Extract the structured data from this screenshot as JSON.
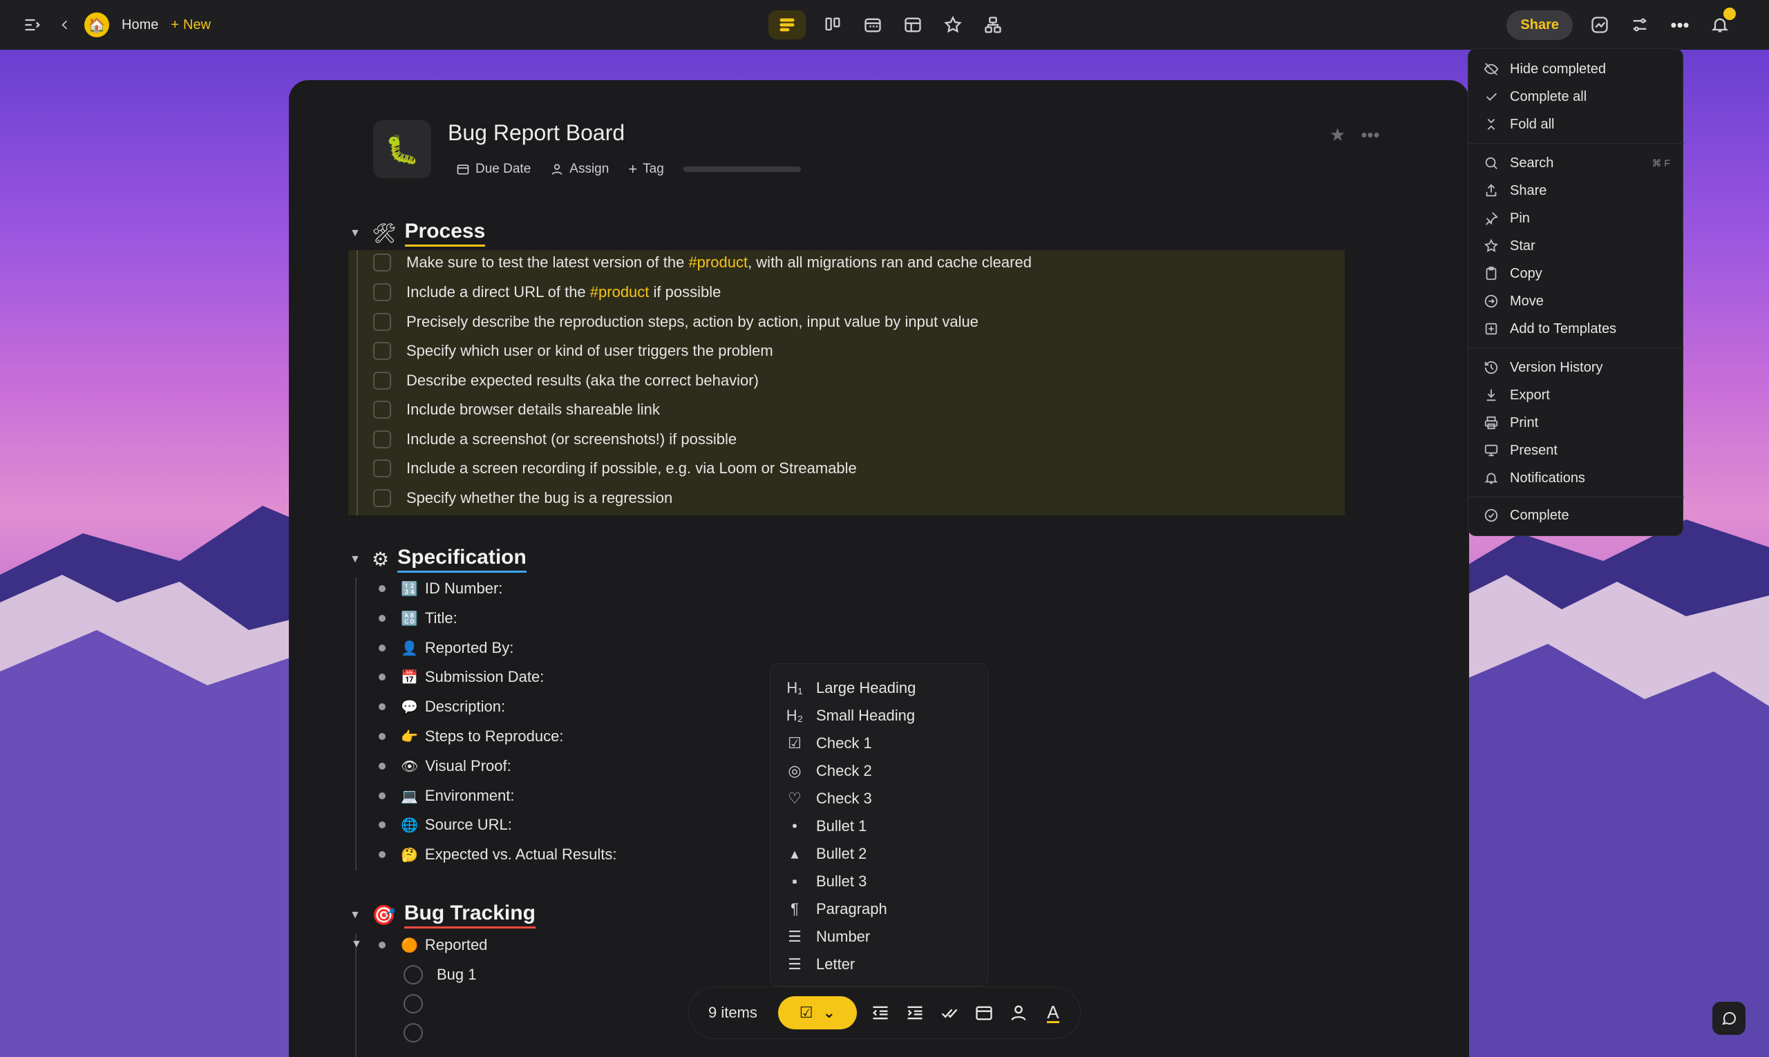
{
  "topbar": {
    "home_label": "Home",
    "new_label": "New",
    "share_label": "Share"
  },
  "document": {
    "title": "Bug Report Board",
    "due_date_label": "Due Date",
    "assign_label": "Assign",
    "tag_label": "Tag"
  },
  "process": {
    "title": "Process",
    "emoji": "🛠",
    "tasks": [
      {
        "pre": "Make sure to test the latest version of the ",
        "tag": "#product",
        "post": ", with all migrations ran and cache cleared"
      },
      {
        "pre": "Include a direct URL of the ",
        "tag": "#product",
        "post": " if possible"
      },
      {
        "pre": "Precisely describe the reproduction steps, action by action, input value by input value",
        "tag": "",
        "post": ""
      },
      {
        "pre": "Specify which user or kind of user triggers the problem",
        "tag": "",
        "post": ""
      },
      {
        "pre": "Describe expected results (aka the correct behavior)",
        "tag": "",
        "post": ""
      },
      {
        "pre": "Include browser details shareable link",
        "tag": "",
        "post": ""
      },
      {
        "pre": "Include a screenshot (or screenshots!) if possible",
        "tag": "",
        "post": ""
      },
      {
        "pre": "Include a screen recording if possible, e.g. via Loom or Streamable",
        "tag": "",
        "post": ""
      },
      {
        "pre": "Specify whether the bug is a regression",
        "tag": "",
        "post": ""
      }
    ]
  },
  "specification": {
    "title": "Specification",
    "emoji": "⚙",
    "items": [
      {
        "emoji": "🔢",
        "label": "ID Number:"
      },
      {
        "emoji": "🔠",
        "label": "Title:"
      },
      {
        "emoji": "👤",
        "label": "Reported By:"
      },
      {
        "emoji": "📅",
        "label": "Submission Date:"
      },
      {
        "emoji": "💬",
        "label": "Description:"
      },
      {
        "emoji": "👉",
        "label": "Steps to Reproduce:"
      },
      {
        "emoji": "👁",
        "label": "Visual Proof:"
      },
      {
        "emoji": "💻",
        "label": "Environment:"
      },
      {
        "emoji": "🌐",
        "label": "Source URL:"
      },
      {
        "emoji": "🤔",
        "label": "Expected vs. Actual Results:"
      }
    ]
  },
  "bug_tracking": {
    "title": "Bug Tracking",
    "emoji": "🎯",
    "status_emoji": "🟠",
    "status_label": "Reported",
    "bug1": "Bug 1"
  },
  "menu": {
    "hide_completed": "Hide completed",
    "complete_all": "Complete all",
    "fold_all": "Fold all",
    "search": "Search",
    "search_shortcut": "⌘ F",
    "share": "Share",
    "pin": "Pin",
    "star": "Star",
    "copy": "Copy",
    "move": "Move",
    "add_to_templates": "Add to Templates",
    "version_history": "Version History",
    "export": "Export",
    "print": "Print",
    "present": "Present",
    "notifications": "Notifications",
    "complete": "Complete"
  },
  "block_menu": {
    "items": [
      {
        "glyph": "H₁",
        "label": "Large Heading"
      },
      {
        "glyph": "H₂",
        "label": "Small Heading"
      },
      {
        "glyph": "☑",
        "label": "Check 1"
      },
      {
        "glyph": "◎",
        "label": "Check 2"
      },
      {
        "glyph": "♡",
        "label": "Check 3"
      },
      {
        "glyph": "•",
        "label": "Bullet 1"
      },
      {
        "glyph": "▴",
        "label": "Bullet 2"
      },
      {
        "glyph": "▪",
        "label": "Bullet 3"
      },
      {
        "glyph": "¶",
        "label": "Paragraph"
      },
      {
        "glyph": "☰",
        "label": "Number"
      },
      {
        "glyph": "☰",
        "label": "Letter"
      }
    ]
  },
  "bottom_bar": {
    "items_count": "9 items",
    "text_format_glyph": "A"
  },
  "colors": {
    "accent": "#f5c518",
    "process_underline": "#f5c518",
    "spec_underline": "#3da6ff",
    "bug_underline": "#ff4a3d"
  }
}
